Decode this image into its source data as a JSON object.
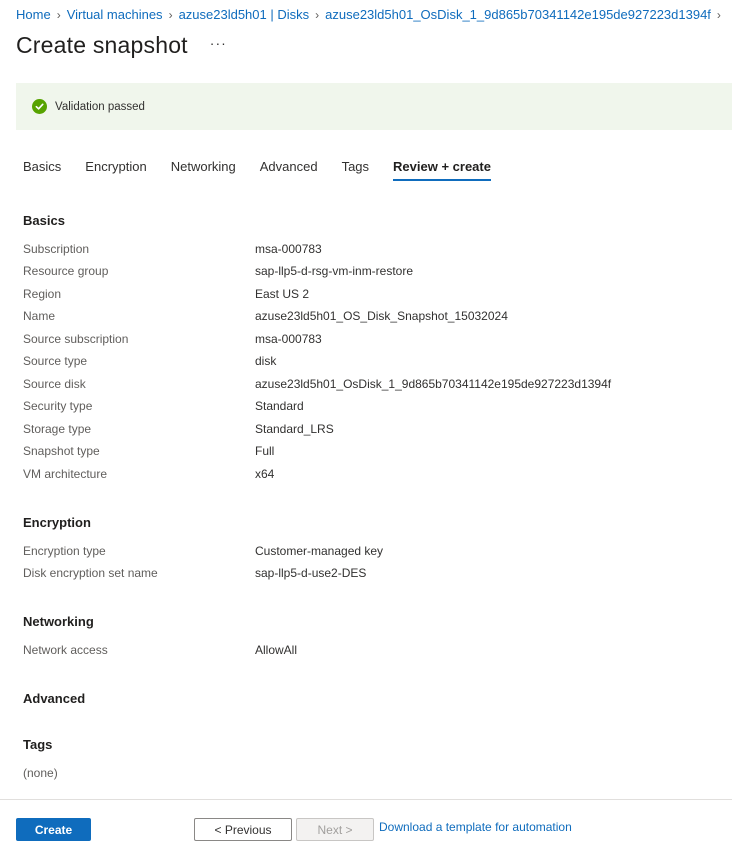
{
  "breadcrumb": {
    "items": [
      "Home",
      "Virtual machines",
      "azuse23ld5h01 | Disks",
      "azuse23ld5h01_OsDisk_1_9d865b70341142e195de927223d1394f"
    ]
  },
  "page": {
    "title": "Create snapshot",
    "more_label": "···"
  },
  "validation": {
    "text": "Validation passed",
    "status_color": "#57a300"
  },
  "tabs": [
    {
      "label": "Basics",
      "active": false
    },
    {
      "label": "Encryption",
      "active": false
    },
    {
      "label": "Networking",
      "active": false
    },
    {
      "label": "Advanced",
      "active": false
    },
    {
      "label": "Tags",
      "active": false
    },
    {
      "label": "Review + create",
      "active": true
    }
  ],
  "sections": {
    "basics": {
      "title": "Basics",
      "rows": [
        {
          "label": "Subscription",
          "value": "msa-000783"
        },
        {
          "label": "Resource group",
          "value": "sap-llp5-d-rsg-vm-inm-restore"
        },
        {
          "label": "Region",
          "value": "East US 2"
        },
        {
          "label": "Name",
          "value": "azuse23ld5h01_OS_Disk_Snapshot_15032024"
        },
        {
          "label": "Source subscription",
          "value": "msa-000783"
        },
        {
          "label": "Source type",
          "value": "disk"
        },
        {
          "label": "Source disk",
          "value": "azuse23ld5h01_OsDisk_1_9d865b70341142e195de927223d1394f"
        },
        {
          "label": "Security type",
          "value": "Standard"
        },
        {
          "label": "Storage type",
          "value": "Standard_LRS"
        },
        {
          "label": "Snapshot type",
          "value": "Full"
        },
        {
          "label": "VM architecture",
          "value": "x64"
        }
      ]
    },
    "encryption": {
      "title": "Encryption",
      "rows": [
        {
          "label": "Encryption type",
          "value": "Customer-managed key"
        },
        {
          "label": "Disk encryption set name",
          "value": "sap-llp5-d-use2-DES"
        }
      ]
    },
    "networking": {
      "title": "Networking",
      "rows": [
        {
          "label": "Network access",
          "value": "AllowAll"
        }
      ]
    },
    "advanced": {
      "title": "Advanced"
    },
    "tags": {
      "title": "Tags",
      "empty_label": "(none)"
    }
  },
  "footer": {
    "create_label": "Create",
    "previous_label": "< Previous",
    "next_label": "Next >",
    "download_label": "Download a template for automation"
  },
  "colors": {
    "accent": "#0f6cbd",
    "validation_bg": "#f0f6ec"
  }
}
